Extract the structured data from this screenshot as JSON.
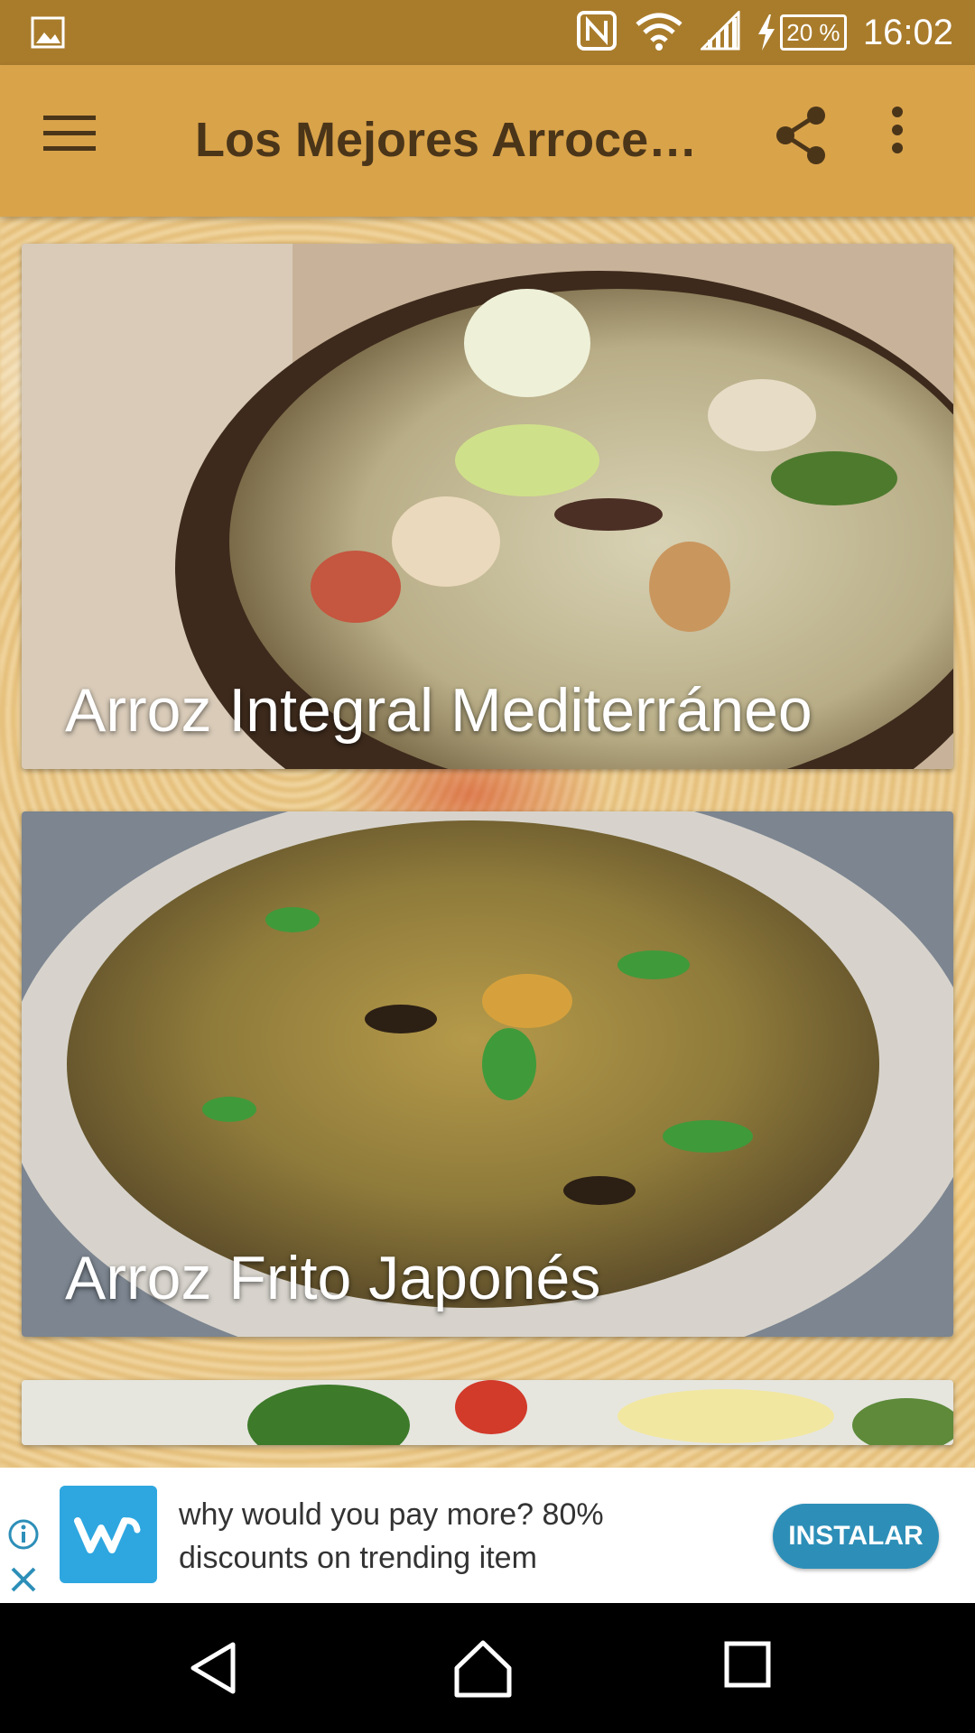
{
  "status_bar": {
    "time": "16:02",
    "battery_percent": "20 %",
    "icons": [
      "gallery-icon",
      "nfc-icon",
      "wifi-icon",
      "signal-icon",
      "charging-icon",
      "battery-icon"
    ]
  },
  "app_bar": {
    "title": "Los Mejores Arroce…",
    "menu_icon": "hamburger-menu-icon",
    "share_icon": "share-icon",
    "overflow_icon": "more-vert-icon",
    "background_color": "#d9a34a",
    "title_color": "#4a3519"
  },
  "recipes": [
    {
      "title": "Arroz Integral Mediterráneo"
    },
    {
      "title": "Arroz Frito Japonés"
    },
    {
      "title": ""
    }
  ],
  "ad": {
    "text": "why would you pay more? 80% discounts on trending item",
    "button_label": "INSTALAR",
    "info_icon": "info-icon",
    "close_icon": "close-icon",
    "logo_icon": "wish-logo-icon",
    "accent_color": "#2d8fb8"
  },
  "nav_bar": {
    "buttons": [
      "back-icon",
      "home-icon",
      "recent-apps-icon"
    ]
  }
}
